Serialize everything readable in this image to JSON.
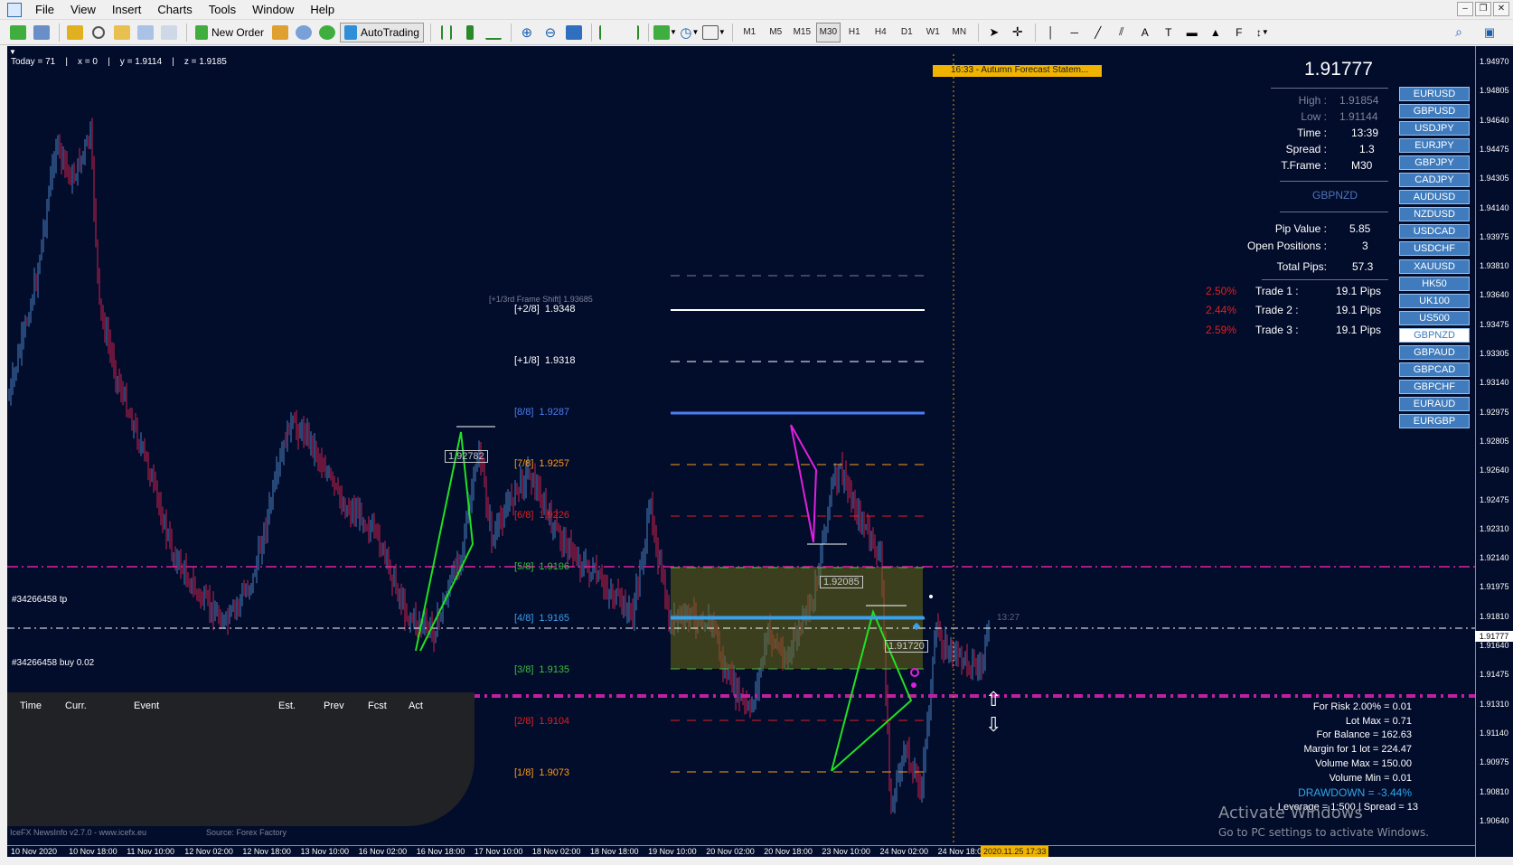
{
  "menu": {
    "items": [
      "File",
      "View",
      "Insert",
      "Charts",
      "Tools",
      "Window",
      "Help"
    ]
  },
  "toolbar": {
    "new_order": "New Order",
    "autotrading": "AutoTrading",
    "timeframes": [
      "M1",
      "M5",
      "M15",
      "M30",
      "H1",
      "H4",
      "D1",
      "W1",
      "MN"
    ],
    "active_timeframe": "M30"
  },
  "chart": {
    "top_status": "Today = 71    |    x = 0    |    y = 1.9114    |    z = 1.9185",
    "news_banner": "16:33 - Autumn Forecast Statem...",
    "frame_shift": "[+1/3rd Frame Shift]  1.93685",
    "fib_levels": [
      {
        "label": "[+2/8]",
        "value": "1.9348",
        "color": "#ffffff"
      },
      {
        "label": "[+1/8]",
        "value": "1.9318",
        "color": "#ffffff"
      },
      {
        "label": "[8/8]",
        "value": "1.9287",
        "color": "#4a7ff0"
      },
      {
        "label": "[7/8]",
        "value": "1.9257",
        "color": "#ff9a1a"
      },
      {
        "label": "[6/8]",
        "value": "1.9226",
        "color": "#e02020"
      },
      {
        "label": "[5/8]",
        "value": "1.9196",
        "color": "#3fbf3f"
      },
      {
        "label": "[4/8]",
        "value": "1.9165",
        "color": "#3aa0e8"
      },
      {
        "label": "[3/8]",
        "value": "1.9135",
        "color": "#3fbf3f"
      },
      {
        "label": "[2/8]",
        "value": "1.9104",
        "color": "#e02020"
      },
      {
        "label": "[1/8]",
        "value": "1.9073",
        "color": "#ff9a1a"
      }
    ],
    "price_tags": [
      "1.92782",
      "1.92085",
      "1.91720"
    ],
    "order_tp_label": "#34266458 tp",
    "order_buy_label": "#34266458 buy 0.02",
    "small_time": "13:27",
    "price_axis": [
      "1.94970",
      "1.94805",
      "1.94640",
      "1.94475",
      "1.94305",
      "1.94140",
      "1.93975",
      "1.93810",
      "1.93640",
      "1.93475",
      "1.93305",
      "1.93140",
      "1.92975",
      "1.92805",
      "1.92640",
      "1.92475",
      "1.92310",
      "1.92140",
      "1.91975",
      "1.91810",
      "1.91640",
      "1.91475",
      "1.91310",
      "1.91140",
      "1.90975",
      "1.90810",
      "1.90640"
    ],
    "current_price": "1.91777",
    "time_axis": [
      "10 Nov 2020",
      "10 Nov 18:00",
      "11 Nov 10:00",
      "12 Nov 02:00",
      "12 Nov 18:00",
      "13 Nov 10:00",
      "16 Nov 02:00",
      "16 Nov 18:00",
      "17 Nov 10:00",
      "18 Nov 02:00",
      "18 Nov 18:00",
      "19 Nov 10:00",
      "20 Nov 02:00",
      "20 Nov 18:00",
      "23 Nov 10:00",
      "24 Nov 02:00",
      "24 Nov 18:00"
    ],
    "time_cursor": "2020.11.25 17:33"
  },
  "info_panel": {
    "price": "1.91777",
    "high_label": "High :",
    "high": "1.91854",
    "low_label": "Low :",
    "low": "1.91144",
    "time_label": "Time :",
    "time": "13:39",
    "spread_label": "Spread :",
    "spread": "1.3",
    "tframe_label": "T.Frame :",
    "tframe": "M30",
    "symbol": "GBPNZD",
    "pip_value_label": "Pip Value :",
    "pip_value": "5.85",
    "open_positions_label": "Open Positions :",
    "open_positions": "3",
    "total_pips_label": "Total Pips:",
    "total_pips": "57.3",
    "trades": [
      {
        "pct": "2.50%",
        "label": "Trade 1 :",
        "pips": "19.1 Pips"
      },
      {
        "pct": "2.44%",
        "label": "Trade 2 :",
        "pips": "19.1 Pips"
      },
      {
        "pct": "2.59%",
        "label": "Trade 3 :",
        "pips": "19.1 Pips"
      }
    ]
  },
  "symbols": [
    "EURUSD",
    "GBPUSD",
    "USDJPY",
    "EURJPY",
    "GBPJPY",
    "CADJPY",
    "AUDUSD",
    "NZDUSD",
    "USDCAD",
    "USDCHF",
    "XAUUSD",
    "HK50",
    "UK100",
    "US500",
    "GBPNZD",
    "GBPAUD",
    "GBPCAD",
    "GBPCHF",
    "EURAUD",
    "EURGBP"
  ],
  "selected_symbol": "GBPNZD",
  "risk_panel": {
    "lines": [
      "For Risk 2.00% = 0.01",
      "Lot Max = 0.71",
      "For Balance = 162.63",
      "Margin for 1 lot = 224.47",
      "Volume Max = 150.00",
      "Volume Min = 0.01"
    ],
    "drawdown": "DRAWDOWN = -3.44%",
    "leverage": "Leverage = 1:500 | Spread = 13"
  },
  "news": {
    "columns": [
      "Time",
      "Curr.",
      "Event",
      "Est.",
      "Prev",
      "Fcst",
      "Act"
    ],
    "footer_left": "IceFX NewsInfo v2.7.0  -  www.icefx.eu",
    "footer_right": "Source: Forex Factory"
  },
  "watermark": {
    "title": "Activate Windows",
    "subtitle": "Go to PC settings to activate Windows."
  },
  "colors": {
    "chart_bg": "#020c2b",
    "bull": "#4a7fc0",
    "bear": "#d0204f",
    "fib_pattern": "#22e022",
    "magenta": "#e020e0",
    "button": "#3f7bbd"
  }
}
